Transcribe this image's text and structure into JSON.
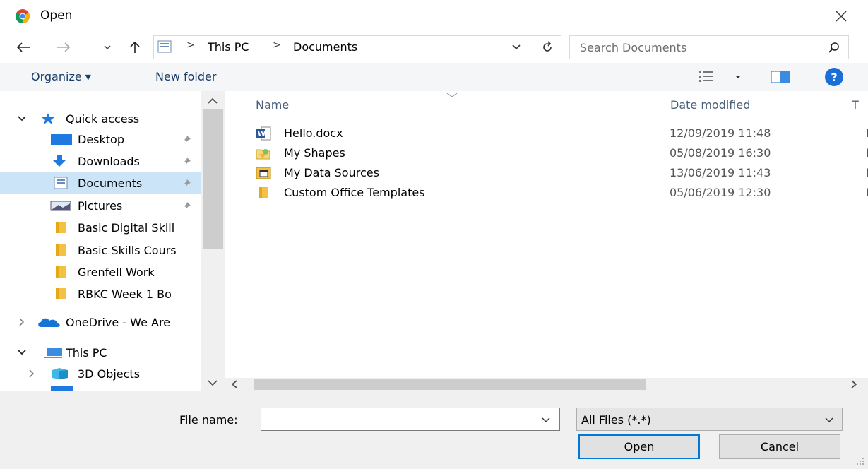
{
  "window": {
    "title": "Open",
    "app_icon": "chrome-icon"
  },
  "navigation": {
    "breadcrumbs": [
      "This PC",
      "Documents"
    ],
    "search_placeholder": "Search Documents"
  },
  "toolbar": {
    "organize": "Organize ▾",
    "new_folder": "New folder",
    "help": "?"
  },
  "sidebar": {
    "items": [
      {
        "label": "Quick access",
        "icon": "star-icon"
      },
      {
        "label": "Desktop",
        "icon": "desktop-icon",
        "pinned": true
      },
      {
        "label": "Downloads",
        "icon": "download-arrow-icon",
        "pinned": true
      },
      {
        "label": "Documents",
        "icon": "documents-icon",
        "pinned": true,
        "selected": true
      },
      {
        "label": "Pictures",
        "icon": "pictures-icon",
        "pinned": true
      },
      {
        "label": "Basic Digital Skill",
        "icon": "folder-icon"
      },
      {
        "label": "Basic Skills Cours",
        "icon": "folder-icon"
      },
      {
        "label": "Grenfell Work",
        "icon": "folder-icon"
      },
      {
        "label": "RBKC Week 1 Bo",
        "icon": "folder-icon"
      },
      {
        "label": "OneDrive - We Are",
        "icon": "onedrive-cloud-icon"
      },
      {
        "label": "This PC",
        "icon": "computer-icon"
      },
      {
        "label": "3D Objects",
        "icon": "3d-objects-icon"
      }
    ]
  },
  "file_list": {
    "columns": [
      "Name",
      "Date modified",
      "T"
    ],
    "rows": [
      {
        "name": "Hello.docx",
        "date": "12/09/2019 11:48",
        "type": "M",
        "icon": "word-document-icon"
      },
      {
        "name": "My Shapes",
        "date": "05/08/2019 16:30",
        "type": "F",
        "icon": "shapes-folder-icon"
      },
      {
        "name": "My Data Sources",
        "date": "13/06/2019 11:43",
        "type": "F",
        "icon": "data-sources-folder-icon"
      },
      {
        "name": "Custom Office Templates",
        "date": "05/06/2019 12:30",
        "type": "F",
        "icon": "folder-icon"
      }
    ]
  },
  "footer": {
    "file_name_label": "File name:",
    "file_name_value": "",
    "filter": "All Files (*.*)",
    "open_label": "Open",
    "cancel_label": "Cancel"
  },
  "colors": {
    "accent": "#0078d7",
    "selection": "#cce4f7",
    "folder": "#f3c244"
  }
}
